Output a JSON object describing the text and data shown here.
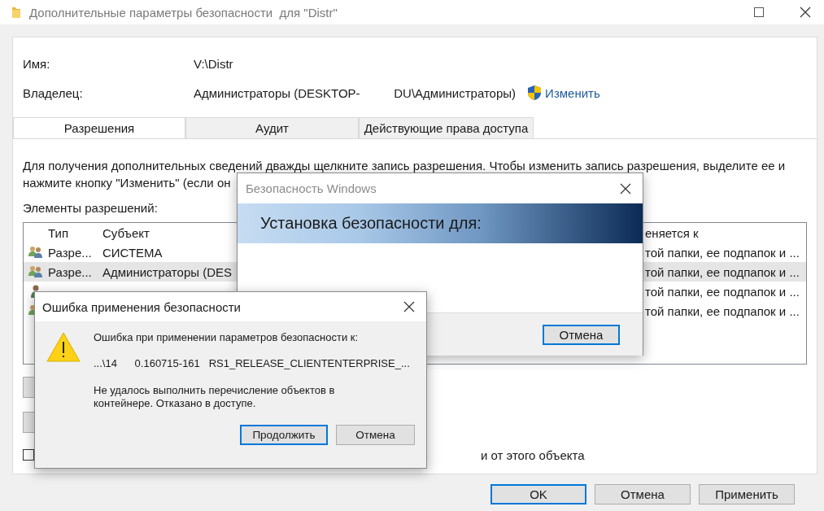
{
  "window": {
    "title": "Дополнительные параметры безопасности  для \"Distr\""
  },
  "name_field": {
    "label": "Имя:",
    "value": "V:\\Distr"
  },
  "owner_field": {
    "label": "Владелец:",
    "value": "Администраторы (DESKTOP-          DU\\Администраторы)",
    "link": "Изменить"
  },
  "tabs": [
    {
      "label": "Разрешения",
      "selected": true
    },
    {
      "label": "Аудит",
      "selected": false
    },
    {
      "label": "Действующие права доступа",
      "selected": false
    }
  ],
  "intro_lines": [
    "Для получения дополнительных сведений дважды щелкните запись разрешения. Чтобы изменить запись разрешения, выделите ее и",
    "нажмите кнопку \"Изменить\" (если он"
  ],
  "permissions": {
    "label": "Элементы разрешений:",
    "columns": [
      "Тип",
      "Субъект",
      "еняется к"
    ],
    "rows": [
      {
        "kind": "group",
        "type": "Разре...",
        "subject": "СИСТЕМА",
        "applies_to": "той папки, ее подпапок и ...",
        "selected": false
      },
      {
        "kind": "group",
        "type": "Разре...",
        "subject": "Администраторы (DES",
        "applies_to": "той папки, ее подпапок и ...",
        "selected": true
      },
      {
        "kind": "user",
        "applies_to": "той папки, ее подпапок и ...",
        "selected": false
      },
      {
        "kind": "group",
        "applies_to": "той папки, ее подпапок и ...",
        "selected": false
      }
    ]
  },
  "inherit_checkbox": {
    "label": "и от этого объекта",
    "checked": false
  },
  "buttons": [
    {
      "label": "OK",
      "default": true
    },
    {
      "label": "Отмена",
      "default": false
    },
    {
      "label": "Применить",
      "default": false
    }
  ],
  "security_dialog": {
    "title": "Безопасность Windows",
    "heading": "Установка безопасности для:",
    "buttons": [
      {
        "label": "Отмена",
        "default": true
      }
    ]
  },
  "error_dialog": {
    "title": "Ошибка применения безопасности",
    "message": "Ошибка при применении параметров безопасности к:",
    "path": "...\\14      0.160715-161   RS1_RELEASE_CLIENTENTERPRISE_...",
    "detail": "Не удалось выполнить перечисление объектов в контейнере. Отказано в доступе.",
    "buttons": [
      {
        "label": "Продолжить",
        "default": true
      },
      {
        "label": "Отмена",
        "default": false
      }
    ]
  }
}
